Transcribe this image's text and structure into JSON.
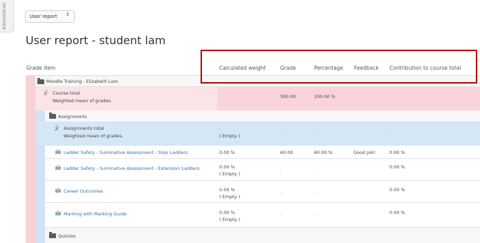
{
  "side_tab": {
    "label": "Administrati"
  },
  "report_selector": {
    "value": "User report",
    "arrow": "⇕"
  },
  "page_title": "User report - student lam",
  "columns": {
    "grade_item": "Grade item",
    "calculated_weight": "Calculated weight",
    "grade": "Grade",
    "percentage": "Percentage",
    "feedback": "Feedback",
    "contribution": "Contribution to course total"
  },
  "course_category": {
    "name": "Moodle Training - Elizabeth Lam"
  },
  "course_total": {
    "name": "Course total",
    "subtitle": "Weighted mean of grades.",
    "weight": "-",
    "grade": "300.00",
    "percentage": "100.00 %",
    "contribution": "-"
  },
  "assignments_category": {
    "name": "Assignments"
  },
  "assignments_total": {
    "name": "Assignments total",
    "subtitle": "Weighted mean of grades.",
    "weight": "-",
    "weight_note": "( Empty )",
    "grade": "-",
    "percentage": "-",
    "contribution": "-"
  },
  "items": [
    {
      "name": "Ladder Safety - Summative Assessment - Step Ladders",
      "weight": "0.00 %",
      "weight_note": "",
      "grade": "60.00",
      "percentage": "60.00 %",
      "feedback": "Good job!",
      "contribution": "0.00 %"
    },
    {
      "name": "Ladder Safety - Summative Assessment - Extension Ladders",
      "weight": "0.00 %",
      "weight_note": "( Empty )",
      "grade": "-",
      "percentage": "-",
      "feedback": "",
      "contribution": "0.00 %"
    },
    {
      "name": "Career Outcomes",
      "weight": "0.00 %",
      "weight_note": "( Empty )",
      "grade": "-",
      "percentage": "-",
      "feedback": "",
      "contribution": "0.00 %"
    },
    {
      "name": "Marking with Marking Guide",
      "weight": "0.00 %",
      "weight_note": "( Empty )",
      "grade": "-",
      "percentage": "-",
      "feedback": "",
      "contribution": "0.00 %"
    }
  ],
  "quizzes_category": {
    "name": "Quizzes"
  },
  "colors": {
    "highlight_border": "#b40000",
    "course_row": "#fad4d9",
    "assign_row": "#d5e6f5",
    "link": "#2a6fa8"
  }
}
